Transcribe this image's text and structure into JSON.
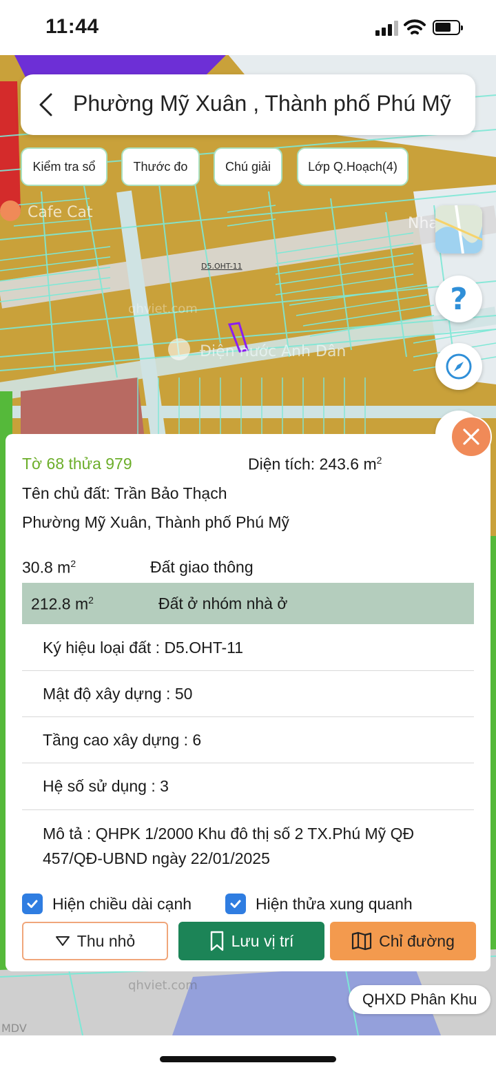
{
  "status_bar": {
    "time": "11:44"
  },
  "header": {
    "title": "Phường Mỹ Xuân , Thành phố Phú Mỹ"
  },
  "toolbar": {
    "chips": [
      "Kiểm tra sổ",
      "Thước đo",
      "Chú giải",
      "Lớp Q.Hoạch(4)"
    ]
  },
  "map": {
    "labels": {
      "poi_cafe": "Cafe Cat",
      "parcel_code": "D5.OHT-11",
      "street": "Điện nước Anh Dân",
      "watermark": "qhviet.com",
      "edge_nha": "Nha",
      "edge_mdv": "MDV"
    },
    "layer_pill": "QHXD Phân Khu"
  },
  "panel": {
    "parcel_id": "Tờ 68 thửa 979",
    "area_prefix": "Diện tích: 243.6 m",
    "area_unit_sup": "2",
    "owner": "Tên chủ đất: Trần Bảo Thạch",
    "address": "Phường Mỹ Xuân, Thành phố Phú Mỹ",
    "allocations": [
      {
        "amount": "30.8 m",
        "sup": "2",
        "type": "Đất giao thông"
      },
      {
        "amount": "212.8 m",
        "sup": "2",
        "type": "Đất ở nhóm nhà ở"
      }
    ],
    "attributes": {
      "land_symbol": "Ký hiệu loại đất : D5.OHT-11",
      "density": "Mật độ xây dựng : 50",
      "height": "Tầng cao xây dựng : 6",
      "coefficient": "Hệ số sử dụng : 3"
    },
    "description_line1": "Mô tả : QHPK 1/2000 Khu đô thị số 2 TX.Phú Mỹ QĐ",
    "description_line2": "457/QĐ-UBND ngày 22/01/2025",
    "checkboxes": {
      "show_edge_length": "Hiện chiều dài cạnh",
      "show_neighbors": "Hiện thửa xung quanh"
    },
    "buttons": {
      "collapse": "Thu nhỏ",
      "save_location": "Lưu vị trí",
      "directions": "Chỉ đường"
    }
  },
  "colors": {
    "residential_land": "#c9a13a",
    "parcel_lines": "#7de8d6",
    "accent_green": "#1c8457",
    "accent_orange": "#f39a4e",
    "checkbox_blue": "#2f7de1",
    "parcel_id_green": "#6cae2a"
  }
}
